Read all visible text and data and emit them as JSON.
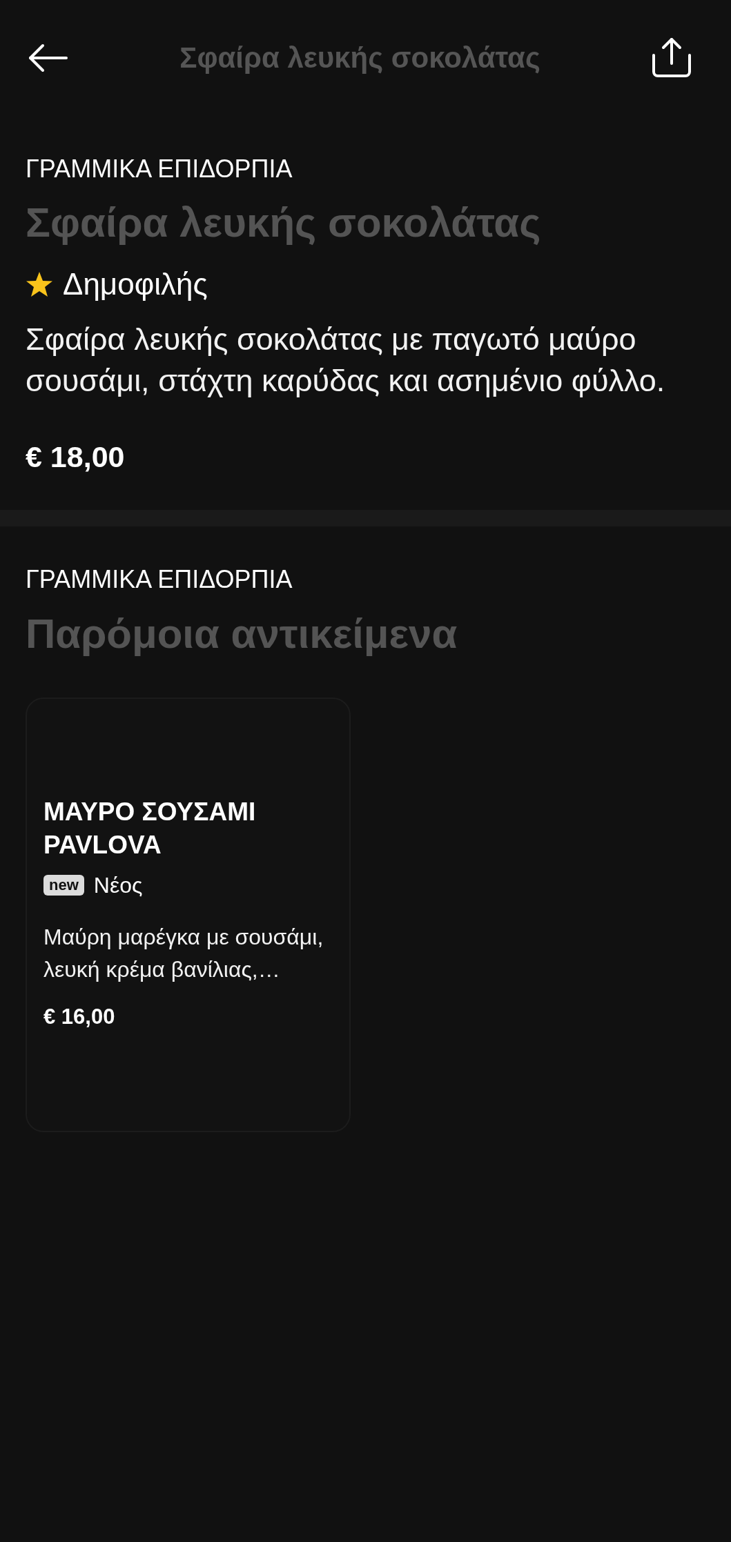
{
  "header": {
    "title": "Σφαίρα λευκής σοκολάτας"
  },
  "product": {
    "category": "ΓΡΑΜΜΙΚΑ ΕΠΙΔΟΡΠΙΑ",
    "name": "Σφαίρα λευκής σοκολάτας",
    "tags": [
      {
        "kind": "star",
        "label": "Δημοφιλής"
      }
    ],
    "description": "Σφαίρα λευκής σοκολάτας με παγωτό μαύρο σουσάμι, στάχτη καρύδας και ασημένιο φύλλο.",
    "price": "€ 18,00"
  },
  "similar": {
    "category": "ΓΡΑΜΜΙΚΑ ΕΠΙΔΟΡΠΙΑ",
    "title": "Παρόμοια αντικείμενα",
    "items": [
      {
        "name": "ΜΑΥΡΟ ΣΟΥΣΑΜΙ PAVLOVA",
        "tags": [
          {
            "kind": "new",
            "badge": "new",
            "label": "Νέος"
          }
        ],
        "description": "Μαύρη μαρέγκα με σουσάμι, λευκή κρέμα βανίλιας,…",
        "price": "€ 16,00"
      }
    ]
  }
}
